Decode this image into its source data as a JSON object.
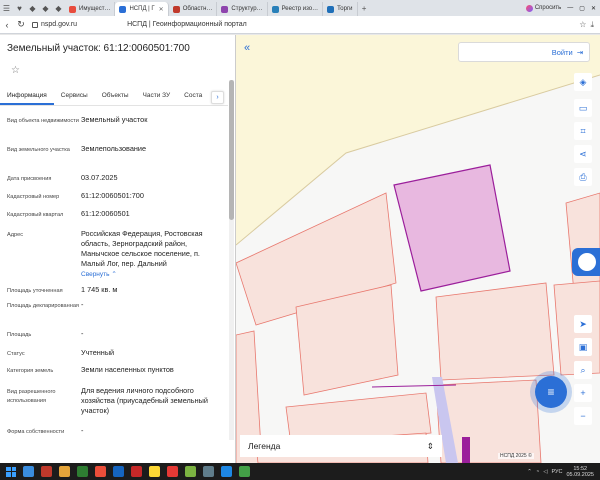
{
  "browser": {
    "tabs": [
      {
        "label": "Имущест…",
        "color": "#e84c3d"
      },
      {
        "label": "НСПД | Г",
        "color": "#2b6fd6",
        "active": true
      },
      {
        "label": "Областн…",
        "color": "#c0392b"
      },
      {
        "label": "Структур…",
        "color": "#8e44ad"
      },
      {
        "label": "Реестр изо…",
        "color": "#2980b9"
      },
      {
        "label": "Торги",
        "color": "#1f6fb8"
      }
    ],
    "ask_label": "Спросить",
    "url": "nspd.gov.ru",
    "page_title": "НСПД | Геоинформационный портал"
  },
  "panel": {
    "title": "Земельный участок: 61:12:0060501:700",
    "tabs": [
      "Информация",
      "Сервисы",
      "Объекты",
      "Части ЗУ",
      "Соста"
    ],
    "collapse_label": "Свернуть",
    "fields": [
      {
        "label": "Вид объекта недвижимости",
        "value": "Земельный участок"
      },
      {
        "label": "Вид земельного участка",
        "value": "Землепользование"
      },
      {
        "label": "Дата присвоения",
        "value": "03.07.2025"
      },
      {
        "label": "Кадастровый номер",
        "value": "61:12:0060501:700"
      },
      {
        "label": "Кадастровый квартал",
        "value": "61:12:0060501"
      },
      {
        "label": "Адрес",
        "value": "Российская Федерация, Ростовская область, Зерноградский район, Манычское сельское поселение, п. Малый Лог, пер. Дальний"
      },
      {
        "label": "Площадь уточненная",
        "value": "1 745 кв. м"
      },
      {
        "label": "Площадь декларированная",
        "value": "-"
      },
      {
        "label": "Площадь",
        "value": "-"
      },
      {
        "label": "Статус",
        "value": "Учтенный"
      },
      {
        "label": "Категория земель",
        "value": "Земли населенных пунктов"
      },
      {
        "label": "Вид разрешенного использования",
        "value": "Для ведения личного подсобного хозяйства (приусадебный земельный участок)"
      },
      {
        "label": "Форма собственности",
        "value": "-"
      }
    ]
  },
  "map": {
    "login_label": "Войти",
    "legend_label": "Легенда",
    "copyright": "НСПД 2025 ©",
    "selected_fill": "#e8b8e0",
    "selected_stroke": "#9b1f9b",
    "parcel_stroke": "#e8786e",
    "parcel_fill": "#f8e2dc",
    "accent": "#2b6fd6"
  },
  "taskbar": {
    "lang": "РУС",
    "time": "15:52",
    "date": "05.09.2025"
  }
}
